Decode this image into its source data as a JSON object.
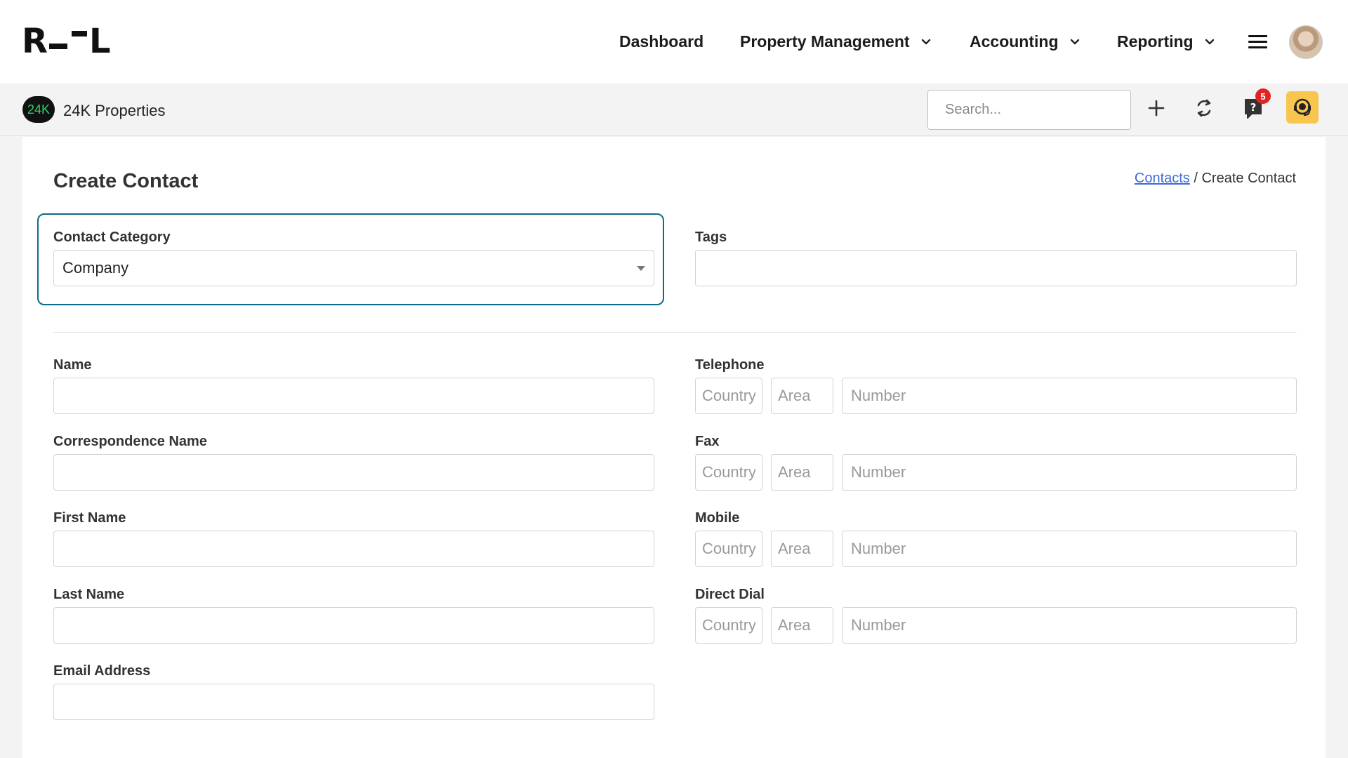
{
  "app": {
    "logo_text": "R--L"
  },
  "nav": {
    "dashboard": "Dashboard",
    "property_management": "Property Management",
    "accounting": "Accounting",
    "reporting": "Reporting"
  },
  "org": {
    "badge": "24K",
    "name": "24K Properties"
  },
  "search": {
    "placeholder": "Search..."
  },
  "notifications": {
    "count": "5"
  },
  "page": {
    "title": "Create Contact",
    "breadcrumb_link": "Contacts",
    "breadcrumb_sep": " / ",
    "breadcrumb_current": "Create Contact"
  },
  "form": {
    "contact_category_label": "Contact Category",
    "contact_category_value": "Company",
    "tags_label": "Tags",
    "name_label": "Name",
    "correspondence_name_label": "Correspondence Name",
    "first_name_label": "First Name",
    "last_name_label": "Last Name",
    "email_label": "Email Address",
    "telephone_label": "Telephone",
    "fax_label": "Fax",
    "mobile_label": "Mobile",
    "direct_dial_label": "Direct Dial",
    "phone_placeholders": {
      "country": "Country",
      "area": "Area",
      "number": "Number"
    }
  },
  "colors": {
    "focus_border": "#0e6b88",
    "badge_red": "#e02424",
    "support_yellow": "#f8c64f",
    "org_green": "#2ed36b",
    "link_blue": "#3f6ad8"
  }
}
